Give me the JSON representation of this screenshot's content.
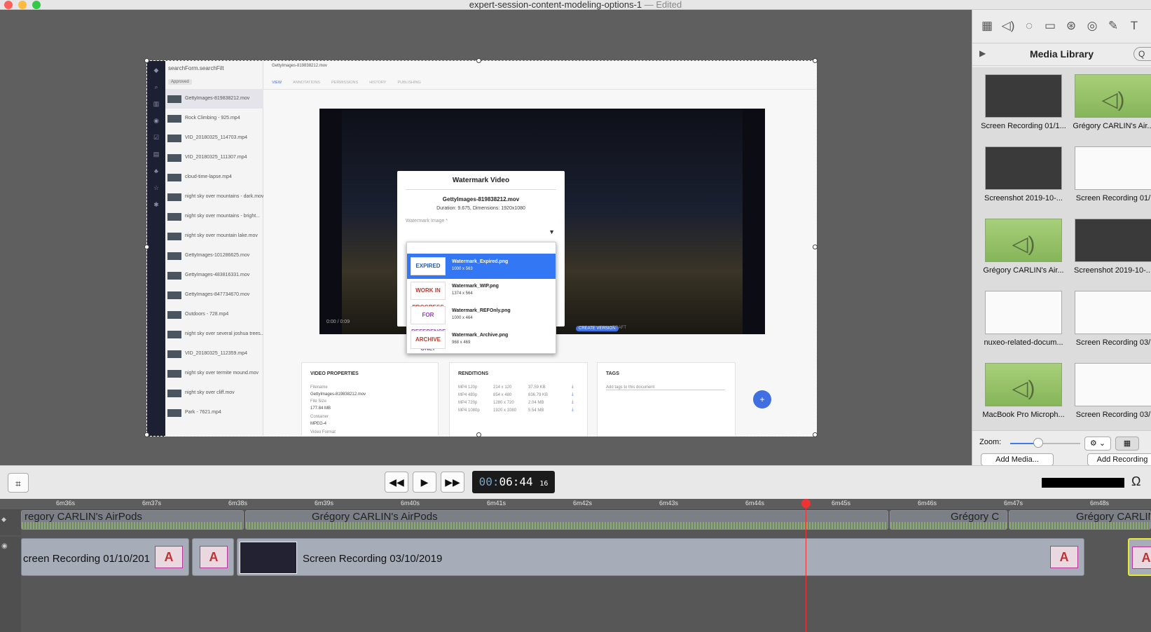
{
  "window": {
    "title": "expert-session-content-modeling-options-1",
    "status": "— Edited"
  },
  "media_library": {
    "title": "Media Library",
    "search_placeholder": "Q",
    "items": [
      {
        "label": "Screen Recording 01/1...",
        "kind": "dark"
      },
      {
        "label": "Grégory CARLIN's Air...",
        "kind": "audio"
      },
      {
        "label": "Screenshot 2019-10-...",
        "kind": "dark"
      },
      {
        "label": "Screen Recording 01/",
        "kind": "white"
      },
      {
        "label": "Grégory CARLIN's Air...",
        "kind": "audio"
      },
      {
        "label": "Screenshot 2019-10-...",
        "kind": "dark"
      },
      {
        "label": "nuxeo-related-docum...",
        "kind": "white"
      },
      {
        "label": "Screen Recording 03/",
        "kind": "white"
      },
      {
        "label": "MacBook Pro Microph...",
        "kind": "audio"
      },
      {
        "label": "Screen Recording 03/",
        "kind": "white"
      }
    ],
    "zoom_label": "Zoom:",
    "zoom_level": 0.4,
    "add_media": "Add Media...",
    "add_recording": "Add Recording"
  },
  "transport": {
    "timecode_hours": "00:",
    "timecode_main": "06:44",
    "timecode_frames": "16"
  },
  "ruler_ticks": [
    "6m36s",
    "6m37s",
    "6m38s",
    "6m39s",
    "6m40s",
    "6m41s",
    "6m42s",
    "6m43s",
    "6m44s",
    "6m45s",
    "6m46s",
    "6m47s",
    "6m48s"
  ],
  "timeline": {
    "audio_clip_1": "regory CARLIN's AirPods",
    "audio_clip_2": "Grégory CARLIN's AirPods",
    "audio_clip_3": "Grégory C",
    "audio_clip_4": "Grégory CARLIN",
    "video_clip_1": "creen Recording 01/10/201",
    "video_clip_2": "Screen Recording 03/10/2019"
  },
  "nuxeo": {
    "search": "searchForm.searchFilt",
    "filter_chip": "Approved",
    "doc_title": "GettyImages-819838212.mov",
    "tabs": [
      "VIEW",
      "ANNOTATIONS",
      "PERMISSIONS",
      "HISTORY",
      "PUBLISHING"
    ],
    "list": [
      "GettyImages-819838212.mov",
      "Rock Climbing - 925.mp4",
      "VID_20180325_114703.mp4",
      "VID_20180325_111307.mp4",
      "cloud-time-lapse.mp4",
      "night sky over mountains - dark.mov",
      "night sky over mountains - bright...",
      "night sky over mountain lake.mov",
      "GettyImages-101286625.mov",
      "GettyImages-483816331.mov",
      "GettyImages-847734670.mov",
      "Outdoors - 728.mp4",
      "night sky over several joshua trees...",
      "VID_20180325_112359.mp4",
      "night sky over termite mound.mov",
      "night sky over cliff.mov",
      "Park - 7621.mp4"
    ],
    "video_time": "0:00 / 0:09",
    "create_version": "CREATE VERSION",
    "draft": "DRAFT",
    "video_properties": {
      "title": "VIDEO PROPERTIES",
      "filename_label": "Filename",
      "filename": "GettyImages-819838212.mov",
      "size_label": "File Size",
      "size": "177.84 MB",
      "container_label": "Container",
      "container": "MPEG-4",
      "format_label": "Video Format"
    },
    "renditions": {
      "title": "RENDITIONS",
      "rows": [
        [
          "MP4 120p",
          "214 x 120",
          "37.59 KB"
        ],
        [
          "MP4 480p",
          "854 x 480",
          "836.79 KB"
        ],
        [
          "MP4 720p",
          "1280 x 720",
          "2.04 MB"
        ],
        [
          "MP4 1080p",
          "1920 x 1080",
          "5.54 MB"
        ]
      ]
    },
    "tags": {
      "title": "TAGS",
      "placeholder": "Add tags to this document"
    }
  },
  "modal": {
    "title": "Watermark Video",
    "file": "GettyImages-819838212.mov",
    "meta": "Duration: 9.675, Dimensions: 1920x1080",
    "field_label": "Watermark Image *",
    "options": [
      {
        "name": "Watermark_Expired.png",
        "dim": "1000 x 563",
        "stamp": "EXPIRED",
        "color": "#2a5aa8"
      },
      {
        "name": "Watermark_WIP.png",
        "dim": "1374 x 564",
        "stamp": "WORK IN PROGRESS",
        "color": "#c0392b"
      },
      {
        "name": "Watermark_REFOnly.png",
        "dim": "1000 x 464",
        "stamp": "FOR REFERENCE ONLY",
        "color": "#8e44ad"
      },
      {
        "name": "Watermark_Archive.png",
        "dim": "968 x 469",
        "stamp": "ARCHIVE",
        "color": "#c0392b"
      }
    ]
  }
}
